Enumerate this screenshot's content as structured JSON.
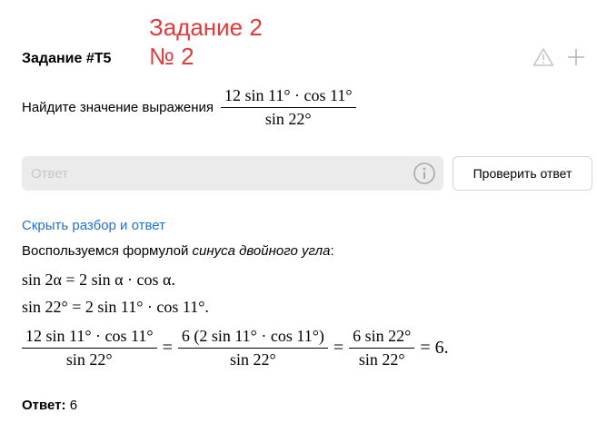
{
  "task": {
    "title": "Задание #T5"
  },
  "annotation": {
    "line1": "Задание 2",
    "line2": "№ 2"
  },
  "problem": {
    "prompt": "Найдите значение выражения",
    "numerator": "12 sin 11° · cos 11°",
    "denominator": "sin 22°"
  },
  "answer_input": {
    "placeholder": "Ответ",
    "value": ""
  },
  "check_button": {
    "label": "Проверить ответ"
  },
  "solution": {
    "toggle_label": "Скрыть разбор и ответ",
    "intro_prefix": "Воспользуемся формулой ",
    "intro_emph": "синуса двойного угла",
    "intro_suffix": ":",
    "formula_1": "sin 2α = 2 sin α · cos α.",
    "formula_2": "sin 22° = 2 sin 11° · cos 11°.",
    "chain": {
      "f1_num": "12 sin 11° · cos 11°",
      "f1_den": "sin 22°",
      "f2_num": "6 (2 sin 11° · cos 11°)",
      "f2_den": "sin 22°",
      "f3_num": "6 sin 22°",
      "f3_den": "sin 22°",
      "eq": "=",
      "result": "= 6."
    }
  },
  "answer": {
    "label": "Ответ:",
    "value": "6"
  },
  "icons": {
    "warning": "warning-icon",
    "add": "plus-icon",
    "info": "info-icon"
  }
}
